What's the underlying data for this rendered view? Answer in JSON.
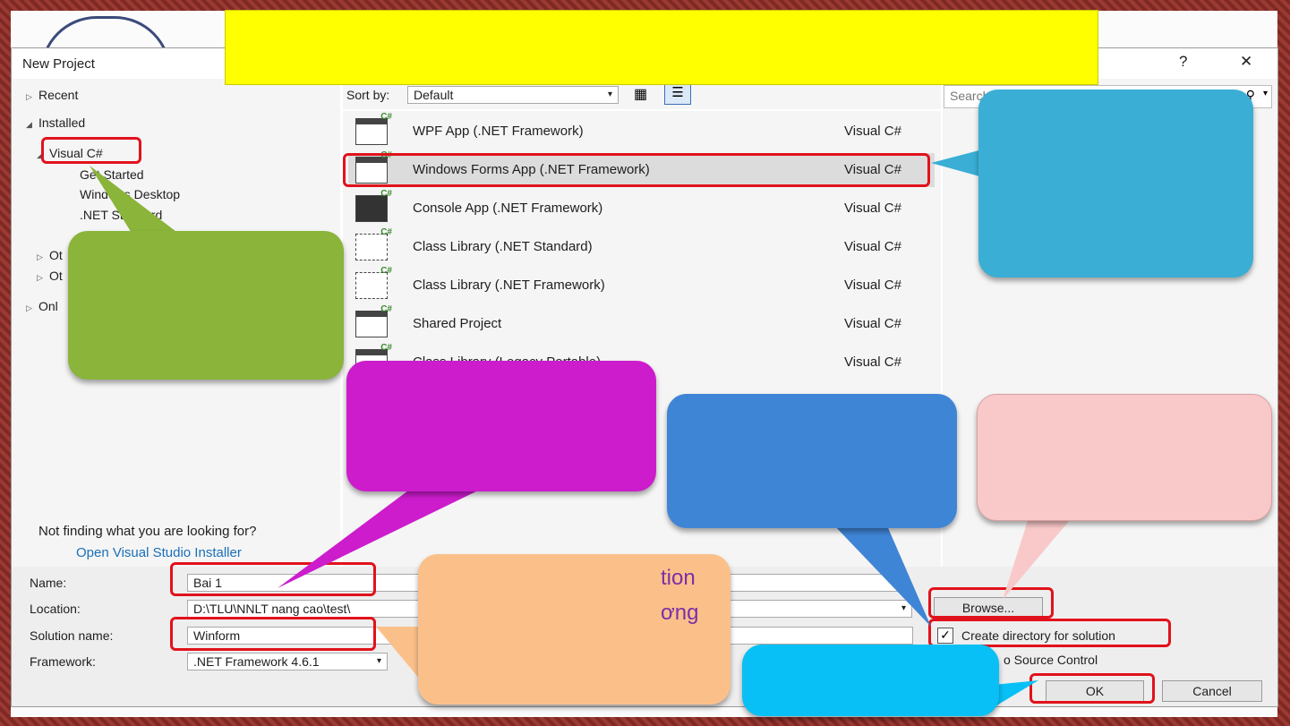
{
  "dialog": {
    "title": "New Project",
    "help_label": "?",
    "close_label": "✕"
  },
  "tree": {
    "recent": "Recent",
    "installed": "Installed",
    "visual_cs": "Visual C#",
    "get_started": "Get Started",
    "windows_desktop": "Windows Desktop",
    "net_standard": ".NET Standard",
    "ot1": "Ot",
    "ot2": "Ot",
    "onl": "Onl"
  },
  "sort": {
    "label": "Sort by:",
    "value": "Default"
  },
  "search": {
    "placeholder": "Search"
  },
  "projects": [
    {
      "name": "WPF App (.NET Framework)",
      "lang": "Visual C#"
    },
    {
      "name": "Windows Forms App (.NET Framework)",
      "lang": "Visual C#"
    },
    {
      "name": "Console App (.NET Framework)",
      "lang": "Visual C#"
    },
    {
      "name": "Class Library (.NET Standard)",
      "lang": "Visual C#"
    },
    {
      "name": "Class Library (.NET Framework)",
      "lang": "Visual C#"
    },
    {
      "name": "Shared Project",
      "lang": "Visual C#"
    },
    {
      "name": "Class Library (Legacy Portable)",
      "lang": "Visual C#"
    }
  ],
  "left_bottom": {
    "not_finding": "Not finding what you are looking for?",
    "installer_link": "Open Visual Studio Installer"
  },
  "form": {
    "name_label": "Name:",
    "name_value": "Bai 1",
    "location_label": "Location:",
    "location_value": "D:\\TLU\\NNLT nang cao\\test\\",
    "solution_label": "Solution name:",
    "solution_value": "Winform",
    "framework_label": "Framework:",
    "framework_value": ".NET Framework 4.6.1",
    "browse_label": "Browse...",
    "create_dir_label": "Create directory for solution",
    "source_control_label": "o Source Control",
    "ok_label": "OK",
    "cancel_label": "Cancel"
  },
  "overlay_text": {
    "line1": "tion",
    "line2": "ơng"
  },
  "colors": {
    "highlight": "#e1121b",
    "banner": "#ffff00",
    "callout_green": "#8ab43a",
    "callout_teal": "#3aaed5",
    "callout_magenta": "#cc1ccc",
    "callout_blue": "#3f85d6",
    "callout_pink": "#f9c9c9",
    "callout_peach": "#fbc08a",
    "callout_cyan": "#08c0f5"
  }
}
